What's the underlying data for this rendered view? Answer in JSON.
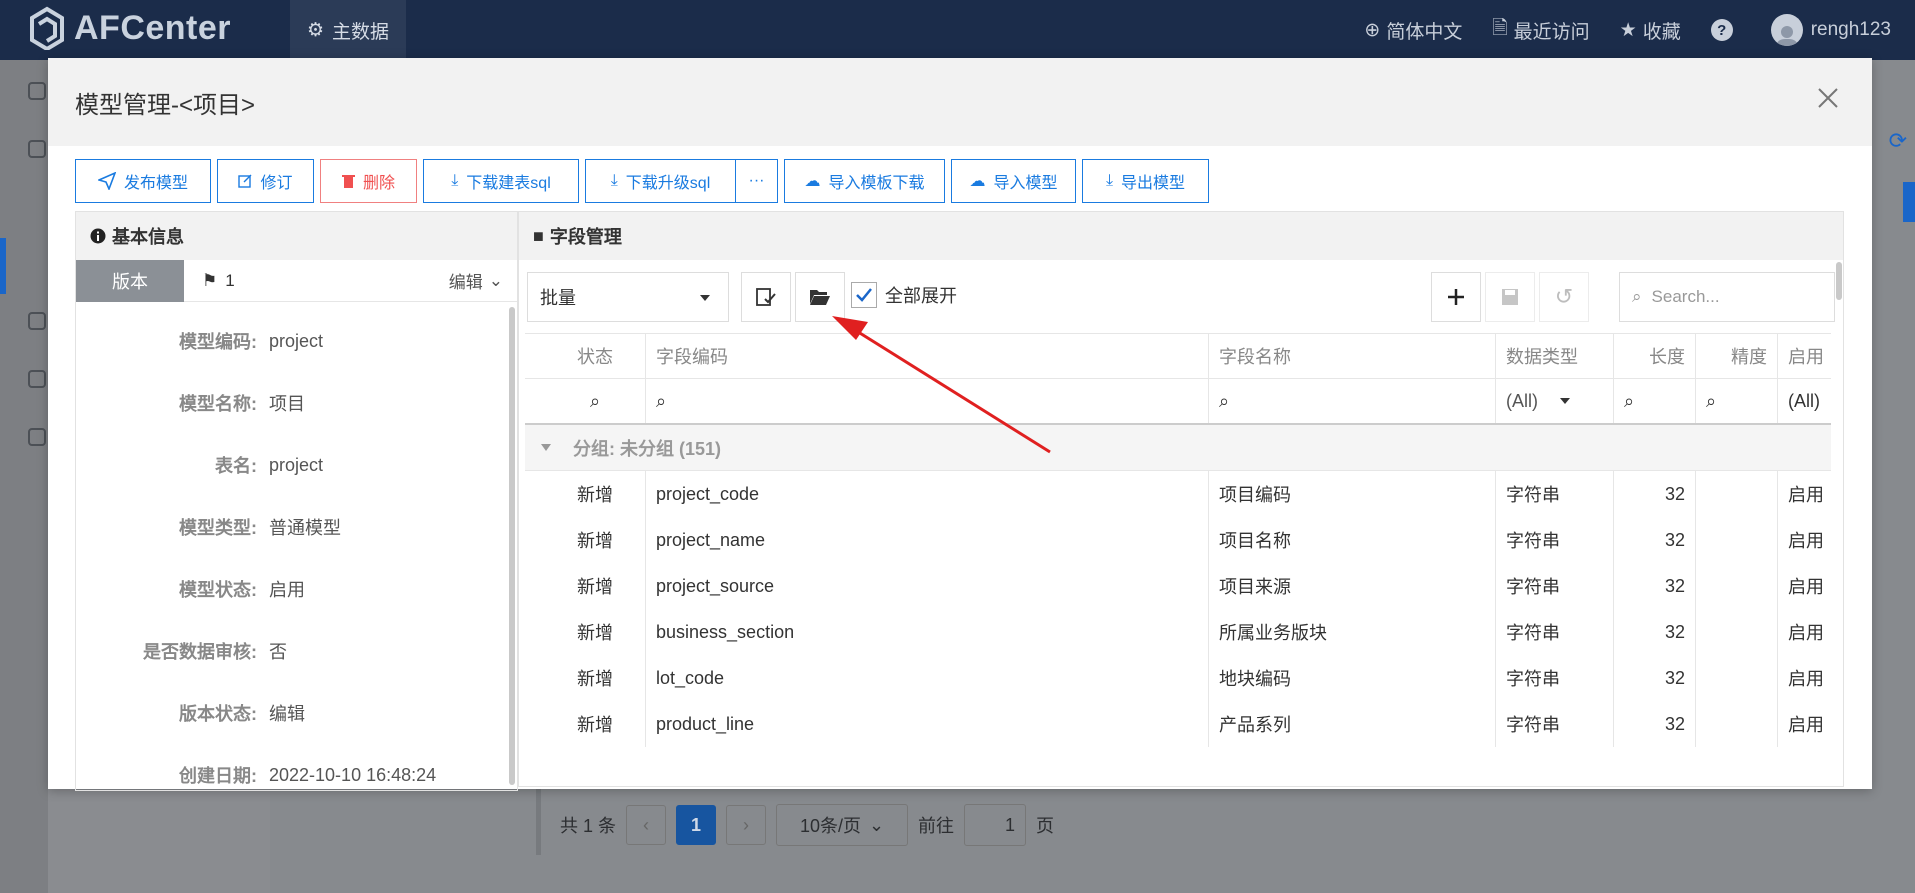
{
  "topbar": {
    "app_name": "AFCenter",
    "nav_tab": "主数据",
    "language": "简体中文",
    "recent": "最近访问",
    "favorites": "收藏",
    "username": "rengh123"
  },
  "modal": {
    "title": "模型管理-<项目>",
    "toolbar": [
      "发布模型",
      "修订",
      "删除",
      "下载建表sql",
      "下载升级sql",
      "导入模板下载",
      "导入模型",
      "导出模型"
    ]
  },
  "basic_info": {
    "title": "基本信息",
    "version_tab": "版本",
    "version_number": "1",
    "edit_label": "编辑",
    "fields": [
      {
        "label": "模型编码:",
        "value": "project"
      },
      {
        "label": "模型名称:",
        "value": "项目"
      },
      {
        "label": "表名:",
        "value": "project"
      },
      {
        "label": "模型类型:",
        "value": "普通模型"
      },
      {
        "label": "模型状态:",
        "value": "启用"
      },
      {
        "label": "是否数据审核:",
        "value": "否"
      },
      {
        "label": "版本状态:",
        "value": "编辑"
      },
      {
        "label": "创建日期:",
        "value": "2022-10-10 16:48:24"
      }
    ]
  },
  "field_mgmt": {
    "title": "字段管理",
    "batch_select": "批量",
    "expand_all": "全部展开",
    "search_placeholder": "Search...",
    "columns": [
      "状态",
      "字段编码",
      "字段名称",
      "数据类型",
      "长度",
      "精度",
      "启用"
    ],
    "filter_all": "(All)",
    "group_label": "分组: 未分组 (151)",
    "rows": [
      {
        "status": "新增",
        "code": "project_code",
        "name": "项目编码",
        "type": "字符串",
        "length": "32",
        "precision": "",
        "enabled": "启用"
      },
      {
        "status": "新增",
        "code": "project_name",
        "name": "项目名称",
        "type": "字符串",
        "length": "32",
        "precision": "",
        "enabled": "启用"
      },
      {
        "status": "新增",
        "code": "project_source",
        "name": "项目来源",
        "type": "字符串",
        "length": "32",
        "precision": "",
        "enabled": "启用"
      },
      {
        "status": "新增",
        "code": "business_section",
        "name": "所属业务版块",
        "type": "字符串",
        "length": "32",
        "precision": "",
        "enabled": "启用"
      },
      {
        "status": "新增",
        "code": "lot_code",
        "name": "地块编码",
        "type": "字符串",
        "length": "32",
        "precision": "",
        "enabled": "启用"
      },
      {
        "status": "新增",
        "code": "product_line",
        "name": "产品系列",
        "type": "字符串",
        "length": "32",
        "precision": "",
        "enabled": "启用"
      }
    ]
  },
  "background_pager": {
    "total": "共 1 条",
    "current_page": "1",
    "page_size": "10条/页",
    "goto_label": "前往",
    "goto_value": "1",
    "page_suffix": "页"
  },
  "colors": {
    "topbar": "#1b2c4a",
    "primary": "#1a7be0",
    "danger": "#f05050",
    "arrow": "#e02020"
  }
}
